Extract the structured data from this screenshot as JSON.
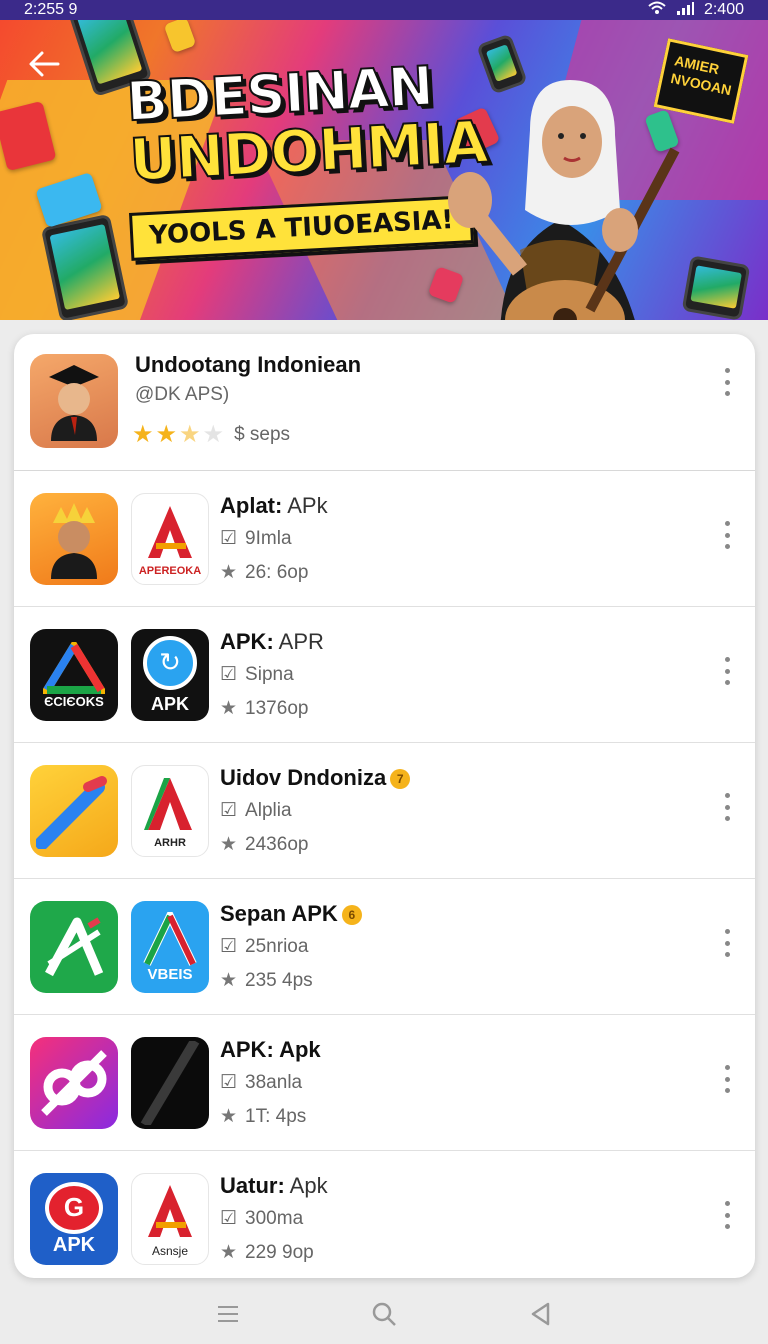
{
  "status_bar": {
    "time_left": "2:255 9",
    "time_right": "2:400"
  },
  "banner": {
    "title_line1": "BDESINAN",
    "title_line2": "UNDOHMIA",
    "tagline": "YOOLS A TIUOEASIA!",
    "sticker_text": "AMIER\nNVOOAN"
  },
  "featured": {
    "title": "Undootang Indoniean",
    "subtitle": "@DK APS)",
    "rating_text": "$ seps"
  },
  "apps": [
    {
      "title": "Aplat:",
      "title_suffix": " APk",
      "sub": "9Imla",
      "rating": "26: 6op",
      "icon2_label": "APEREOKA"
    },
    {
      "title": "APK:",
      "title_suffix": " APR",
      "sub": "Sipna",
      "rating": "1376op",
      "icon1_label": "ЄCIЄOKS",
      "icon2_label": "APK"
    },
    {
      "title": "Uidov Dndoniza",
      "title_suffix": "",
      "badge": "7",
      "sub": "Alplia",
      "rating": "2436op",
      "icon2_label": "ARHR"
    },
    {
      "title": "Sepan APK",
      "title_suffix": "",
      "badge": "6",
      "sub": "25nrioa",
      "rating": "235 4ps",
      "icon2_label": "VBEIS"
    },
    {
      "title": "APK: Apk",
      "title_suffix": "",
      "sub": "38anla",
      "rating": "1T: 4ps"
    },
    {
      "title": "Uatur:",
      "title_suffix": " Apk",
      "sub": "300ma",
      "rating": "229 9op",
      "icon1_label": "APK",
      "icon2_label": "Asnsje"
    }
  ],
  "colors": {
    "accent": "#f5b31b",
    "star": "#f5b31b",
    "banner_yellow": "#ffe23a"
  }
}
